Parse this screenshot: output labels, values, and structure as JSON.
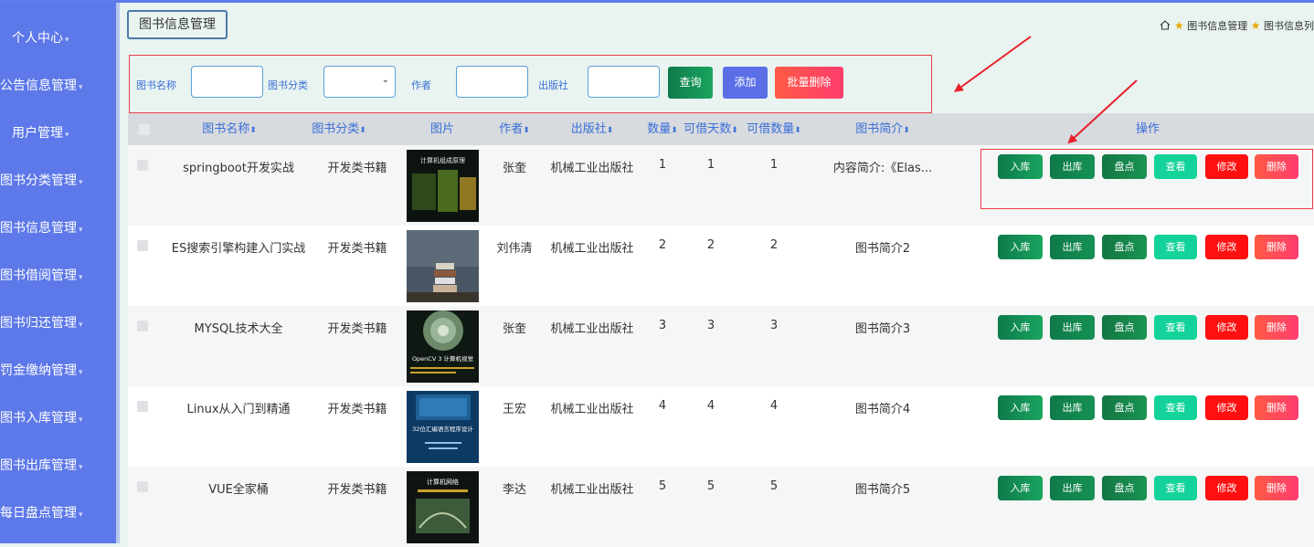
{
  "sidebar": {
    "items": [
      {
        "label": "个人中心"
      },
      {
        "label": "公告信息管理"
      },
      {
        "label": "用户管理"
      },
      {
        "label": "图书分类管理"
      },
      {
        "label": "图书信息管理"
      },
      {
        "label": "图书借阅管理"
      },
      {
        "label": "图书归还管理"
      },
      {
        "label": "罚金缴纳管理"
      },
      {
        "label": "图书入库管理"
      },
      {
        "label": "图书出库管理"
      },
      {
        "label": "每日盘点管理"
      }
    ]
  },
  "header": {
    "title_button": "图书信息管理",
    "breadcrumb": [
      "图书信息管理",
      "图书信息列"
    ]
  },
  "search": {
    "name_label": "图书名称",
    "category_label": "图书分类",
    "author_label": "作者",
    "publisher_label": "出版社",
    "query_button": "查询",
    "add_button": "添加",
    "batch_delete_button": "批量删除"
  },
  "table": {
    "columns": {
      "name": "图书名称",
      "category": "图书分类",
      "image": "图片",
      "author": "作者",
      "publisher": "出版社",
      "quantity": "数量",
      "days": "可借天数",
      "available": "可借数量",
      "intro": "图书简介",
      "ops": "操作"
    },
    "rows": [
      {
        "name": "springboot开发实战",
        "category": "开发类书籍",
        "author": "张奎",
        "publisher": "机械工业出版社",
        "quantity": "1",
        "days": "1",
        "available": "1",
        "intro": "内容简介:《Elas...",
        "cover_text": "计算机组成原理"
      },
      {
        "name": "ES搜索引擎构建入门实战",
        "category": "开发类书籍",
        "author": "刘伟清",
        "publisher": "机械工业出版社",
        "quantity": "2",
        "days": "2",
        "available": "2",
        "intro": "图书简介2",
        "cover_text": ""
      },
      {
        "name": "MYSQL技术大全",
        "category": "开发类书籍",
        "author": "张奎",
        "publisher": "机械工业出版社",
        "quantity": "3",
        "days": "3",
        "available": "3",
        "intro": "图书简介3",
        "cover_text": "OpenCV 3 计算机视觉"
      },
      {
        "name": "Linux从入门到精通",
        "category": "开发类书籍",
        "author": "王宏",
        "publisher": "机械工业出版社",
        "quantity": "4",
        "days": "4",
        "available": "4",
        "intro": "图书简介4",
        "cover_text": "32位汇编语言程序设计"
      },
      {
        "name": "VUE全家桶",
        "category": "开发类书籍",
        "author": "李达",
        "publisher": "机械工业出版社",
        "quantity": "5",
        "days": "5",
        "available": "5",
        "intro": "图书简介5",
        "cover_text": "计算机网络"
      }
    ],
    "actions": {
      "in": "入库",
      "out": "出库",
      "check": "盘点",
      "view": "查看",
      "edit": "修改",
      "delete": "删除"
    }
  },
  "colors": {
    "sidebar": "#5d78e8",
    "accent_text": "#3a6fd8",
    "highlight_red": "#e8404a"
  }
}
